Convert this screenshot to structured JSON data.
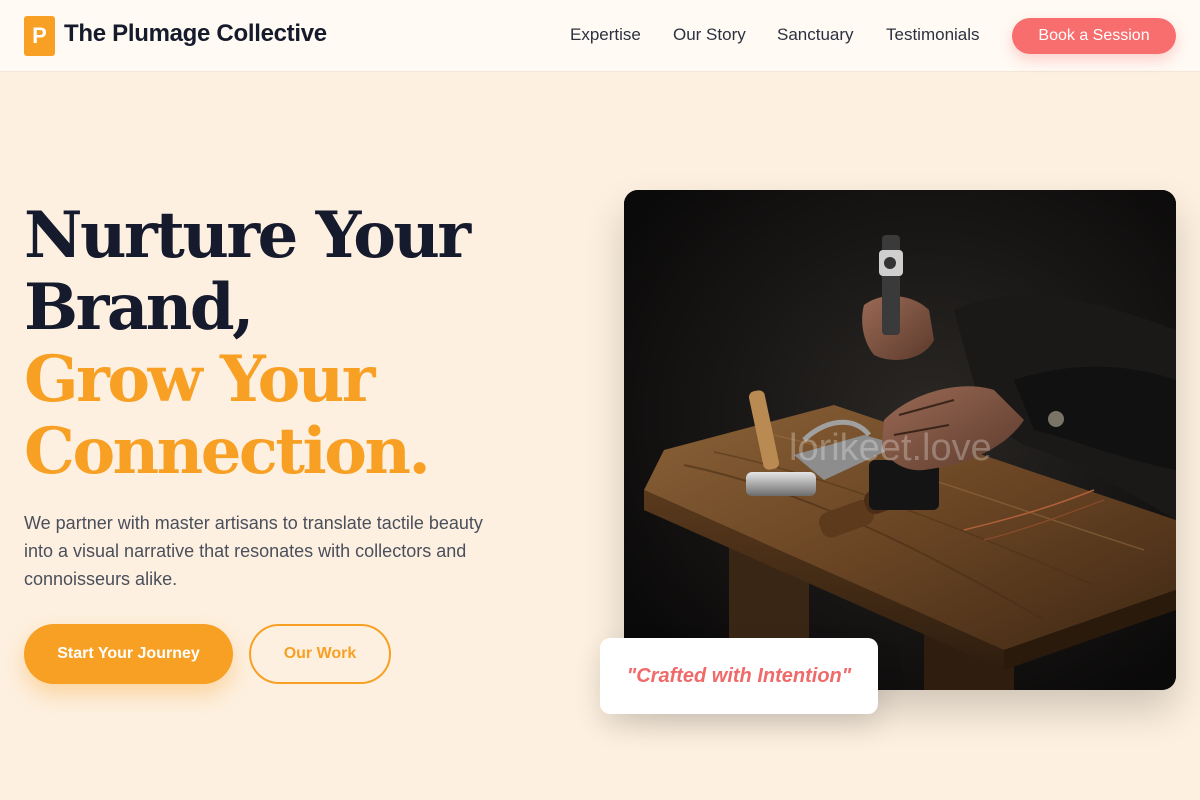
{
  "brand": {
    "logo_letter": "P",
    "name": "The Plumage Collective"
  },
  "nav": {
    "links": [
      "Expertise",
      "Our Story",
      "Sanctuary",
      "Testimonials"
    ],
    "cta": "Book a Session"
  },
  "hero": {
    "headline_line1": "Nurture Your",
    "headline_line2": "Brand,",
    "highlight_line1": "Grow Your",
    "highlight_line2": "Connection.",
    "description": "We partner with master artisans to translate tactile beauty into a visual narrative that resonates with collectors and connoisseurs alike.",
    "primary_button": "Start Your Journey",
    "secondary_button": "Our Work"
  },
  "image": {
    "subject": "artisan hands hammering at a wooden workbench",
    "watermark": "lorikeet.love"
  },
  "quote_card": {
    "text": "\"Crafted with Intention\""
  },
  "colors": {
    "accent": "#f8a024",
    "cta": "#f86d6d",
    "heading": "#151a2d",
    "background": "#fdf0e0"
  }
}
